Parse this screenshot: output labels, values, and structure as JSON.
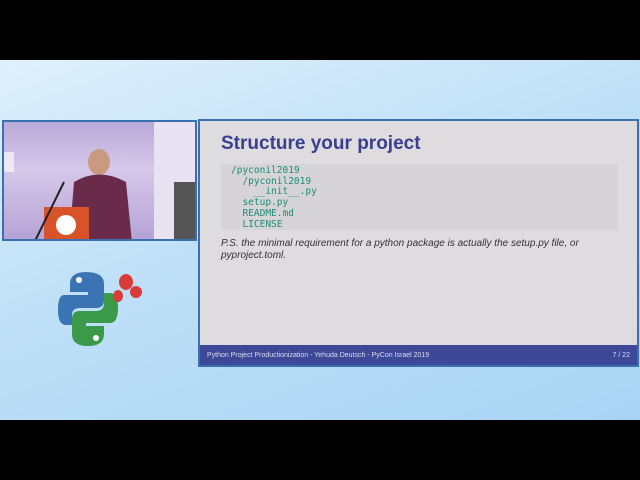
{
  "slide": {
    "title": "Structure your project",
    "code_lines": [
      "/pyconil2019",
      "  /pyconil2019",
      "    __init__.py",
      "  setup.py",
      "  README.md",
      "  LICENSE"
    ],
    "note": "P.S. the minimal requirement for a python package is actually the setup.py file, or pyproject.toml.",
    "footer": "Python Project Productionization - Yehuda Deutsch - PyCon Israel 2019",
    "page": "7 / 22"
  },
  "colors": {
    "title": "#3a3f8f",
    "footer_bg": "#3e4899",
    "code": "#1e8c76"
  }
}
